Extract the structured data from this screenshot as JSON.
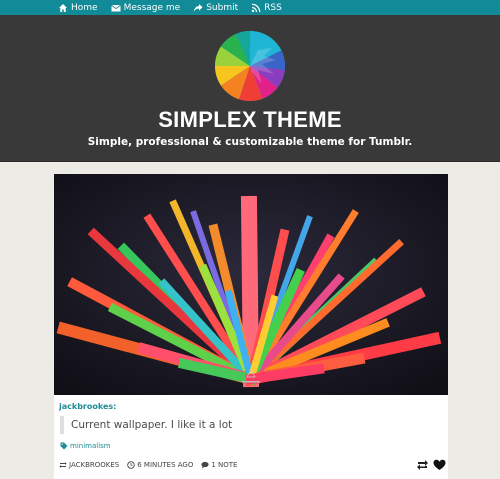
{
  "nav": {
    "items": [
      {
        "label": "Home",
        "icon": "home-icon"
      },
      {
        "label": "Message me",
        "icon": "envelope-icon"
      },
      {
        "label": "Submit",
        "icon": "share-arrow-icon"
      },
      {
        "label": "RSS",
        "icon": "rss-icon"
      }
    ]
  },
  "header": {
    "title": "SIMPLEX THEME",
    "description": "Simple, professional & customizable theme for Tumblr.",
    "logo_icon": "rainbow-spiral-logo"
  },
  "post": {
    "image_alt": "colorful 3D bars wallpaper",
    "author": "jackbrookes:",
    "quote": "Current wallpaper. I like it a lot",
    "tag": "minimalism",
    "meta": {
      "reblogged_from": "JACKBROOKES",
      "time": "6 MINUTES AGO",
      "notes": "1 NOTE"
    }
  },
  "colors": {
    "topbar": "#108b97",
    "header": "#393939",
    "background": "#ecebe6",
    "link": "#1d8c95"
  }
}
